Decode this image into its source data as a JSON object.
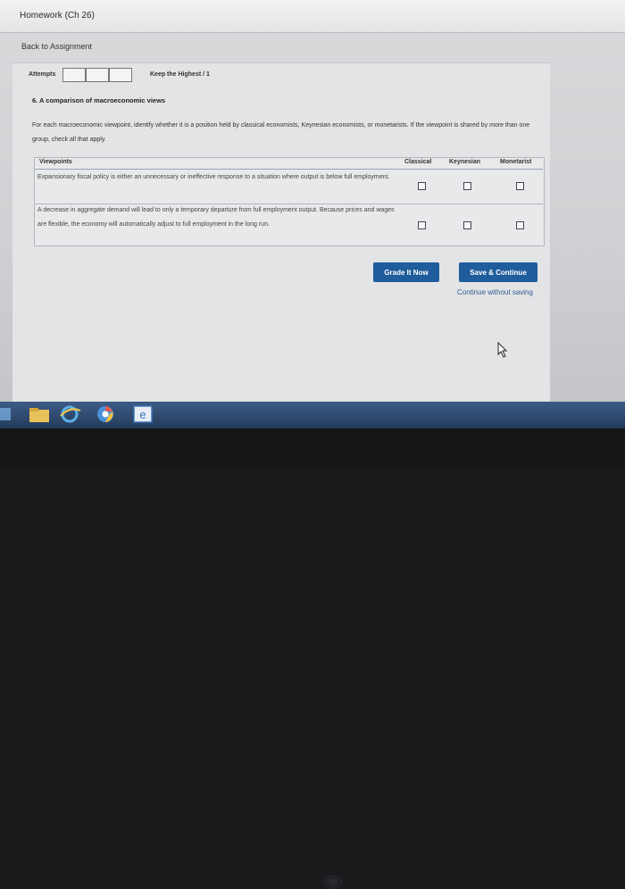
{
  "window": {
    "title": "Homework (Ch 26)"
  },
  "nav": {
    "back_link": "Back to Assignment"
  },
  "attempts": {
    "label": "Attempts",
    "keep_highest": "Keep the Highest / 1"
  },
  "question": {
    "title": "6. A comparison of macroeconomic views",
    "instructions": "For each macroeconomic viewpoint, identify whether it is a position held by classical economists, Keynesian economists, or monetarists. If the viewpoint is shared by more than one group, check all that apply."
  },
  "table": {
    "headers": {
      "viewpoints": "Viewpoints",
      "classical": "Classical",
      "keynesian": "Keynesian",
      "monetarist": "Monetarist"
    },
    "rows": [
      {
        "text": "Expansionary fiscal policy is either an unnecessary or ineffective response to a situation where output is below full employment.",
        "classical": false,
        "keynesian": false,
        "monetarist": false
      },
      {
        "text": "A decrease in aggregate demand will lead to only a temporary departure from full employment output. Because prices and wages are flexible, the economy will automatically adjust to full employment in the long run.",
        "classical": false,
        "keynesian": false,
        "monetarist": false
      }
    ]
  },
  "actions": {
    "grade": "Grade It Now",
    "save": "Save & Continue",
    "continue_link": "Continue without saving"
  },
  "taskbar": {
    "items": [
      "windows-start-icon",
      "file-explorer-icon",
      "internet-explorer-icon",
      "chrome-icon",
      "edge-icon"
    ]
  },
  "colors": {
    "button_blue": "#1f5d9c",
    "link_blue": "#2f5b91",
    "taskbar": "#2d4a70"
  }
}
